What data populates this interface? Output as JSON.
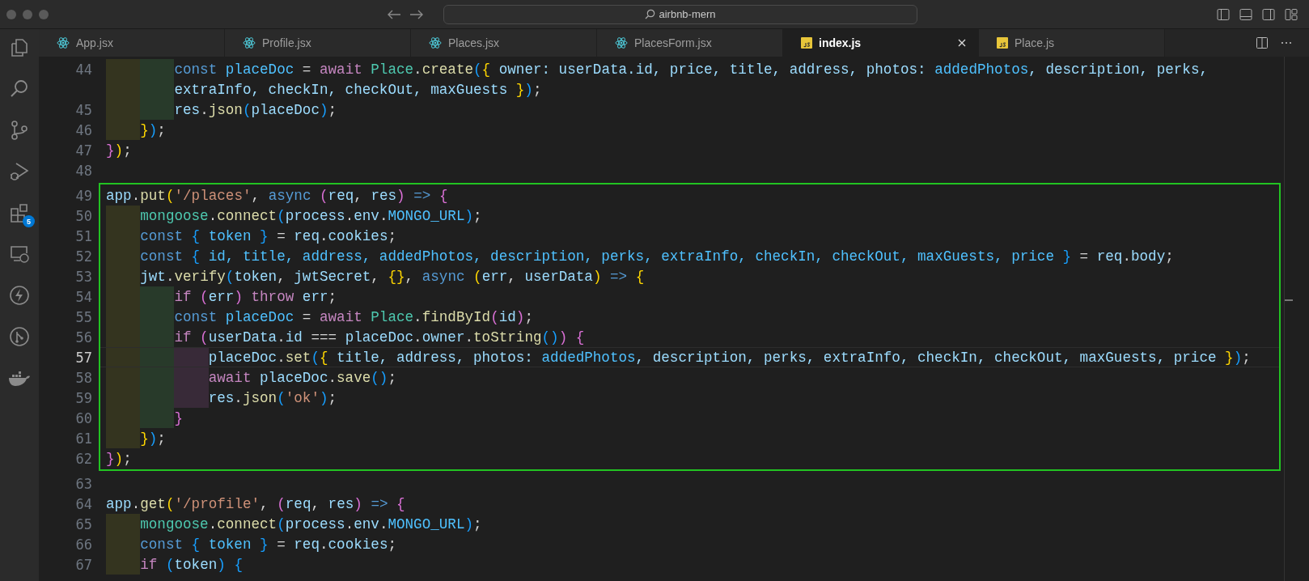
{
  "window": {
    "title": "airbnb-mern"
  },
  "activity_bar": [
    {
      "kind": "files"
    },
    {
      "kind": "search"
    },
    {
      "kind": "source-control"
    },
    {
      "kind": "run-debug"
    },
    {
      "kind": "extensions",
      "badge": "5"
    },
    {
      "kind": "remote"
    },
    {
      "kind": "lightning"
    },
    {
      "kind": "git-graph"
    },
    {
      "kind": "docker"
    }
  ],
  "tabs": [
    {
      "label": "App.jsx",
      "kind": "react",
      "selected": false
    },
    {
      "label": "Profile.jsx",
      "kind": "react",
      "selected": false
    },
    {
      "label": "Places.jsx",
      "kind": "react",
      "selected": false
    },
    {
      "label": "PlacesForm.jsx",
      "kind": "react",
      "selected": false
    },
    {
      "label": "index.js",
      "kind": "js",
      "selected": true
    },
    {
      "label": "Place.js",
      "kind": "js",
      "selected": false
    }
  ],
  "editor": {
    "blocks": [
      {
        "highlighted": false,
        "rows": [
          {
            "number": "44",
            "current": false,
            "guides": [
              {
                "color": "#34341f"
              },
              {
                "color": "#283a2a"
              }
            ],
            "tokens": [
              {
                "kind": "storage",
                "text": "const"
              },
              {
                "kind": "const",
                "text": " placeDoc"
              },
              {
                "kind": "plain",
                "text": " = "
              },
              {
                "kind": "keyword",
                "text": "await"
              },
              {
                "kind": "class",
                "text": " Place"
              },
              {
                "kind": "plain",
                "text": "."
              },
              {
                "kind": "function",
                "text": "create"
              },
              {
                "kind": "b3",
                "text": "("
              },
              {
                "kind": "b1",
                "text": "{"
              },
              {
                "kind": "variable",
                "text": " owner: userData.id, price, title, address, photos: "
              },
              {
                "kind": "const",
                "text": "addedPhotos"
              },
              {
                "kind": "variable",
                "text": ", description, perks,"
              }
            ]
          },
          {
            "current": false,
            "guides": [
              {
                "color": "#34341f"
              },
              {
                "color": "#283a2a"
              }
            ],
            "tokens": [
              {
                "kind": "variable",
                "text": "extraInfo, checkIn, checkOut, maxGuests "
              },
              {
                "kind": "b1",
                "text": "}"
              },
              {
                "kind": "b3",
                "text": ")"
              },
              {
                "kind": "plain",
                "text": ";"
              }
            ]
          },
          {
            "number": "45",
            "current": false,
            "guides": [
              {
                "color": "#34341f"
              },
              {
                "color": "#283a2a"
              }
            ],
            "tokens": [
              {
                "kind": "variable",
                "text": "res"
              },
              {
                "kind": "plain",
                "text": "."
              },
              {
                "kind": "function",
                "text": "json"
              },
              {
                "kind": "b3",
                "text": "("
              },
              {
                "kind": "variable",
                "text": "placeDoc"
              },
              {
                "kind": "b3",
                "text": ")"
              },
              {
                "kind": "plain",
                "text": ";"
              }
            ]
          },
          {
            "number": "46",
            "current": false,
            "guides": [
              {
                "color": "#34341f"
              }
            ],
            "tokens": [
              {
                "kind": "b1",
                "text": "}"
              },
              {
                "kind": "b3",
                "text": ")"
              },
              {
                "kind": "plain",
                "text": ";"
              }
            ]
          },
          {
            "number": "47",
            "current": false,
            "guides": [],
            "tokens": [
              {
                "kind": "b2",
                "text": "}"
              },
              {
                "kind": "b1",
                "text": ")"
              },
              {
                "kind": "plain",
                "text": ";"
              }
            ]
          },
          {
            "number": "48",
            "current": false,
            "guides": [],
            "tokens": []
          }
        ]
      },
      {
        "highlighted": true,
        "rows": [
          {
            "number": "49",
            "current": false,
            "guides": [],
            "tokens": [
              {
                "kind": "variable",
                "text": "app"
              },
              {
                "kind": "plain",
                "text": "."
              },
              {
                "kind": "function",
                "text": "put"
              },
              {
                "kind": "b1",
                "text": "("
              },
              {
                "kind": "string",
                "text": "'/places'"
              },
              {
                "kind": "plain",
                "text": ", "
              },
              {
                "kind": "storage",
                "text": "async"
              },
              {
                "kind": "b2",
                "text": " ("
              },
              {
                "kind": "variable",
                "text": "req"
              },
              {
                "kind": "plain",
                "text": ", "
              },
              {
                "kind": "variable",
                "text": "res"
              },
              {
                "kind": "b2",
                "text": ")"
              },
              {
                "kind": "storage",
                "text": " =>"
              },
              {
                "kind": "b2",
                "text": " {"
              }
            ]
          },
          {
            "number": "50",
            "current": false,
            "guides": [
              {
                "color": "#34341f"
              }
            ],
            "tokens": [
              {
                "kind": "class",
                "text": "mongoose"
              },
              {
                "kind": "plain",
                "text": "."
              },
              {
                "kind": "function",
                "text": "connect"
              },
              {
                "kind": "b3",
                "text": "("
              },
              {
                "kind": "variable",
                "text": "process"
              },
              {
                "kind": "plain",
                "text": "."
              },
              {
                "kind": "variable",
                "text": "env"
              },
              {
                "kind": "plain",
                "text": "."
              },
              {
                "kind": "const",
                "text": "MONGO_URL"
              },
              {
                "kind": "b3",
                "text": ")"
              },
              {
                "kind": "plain",
                "text": ";"
              }
            ]
          },
          {
            "number": "51",
            "current": false,
            "guides": [
              {
                "color": "#34341f"
              }
            ],
            "tokens": [
              {
                "kind": "storage",
                "text": "const"
              },
              {
                "kind": "b3",
                "text": " {"
              },
              {
                "kind": "const",
                "text": " token"
              },
              {
                "kind": "b3",
                "text": " }"
              },
              {
                "kind": "plain",
                "text": " = "
              },
              {
                "kind": "variable",
                "text": "req"
              },
              {
                "kind": "plain",
                "text": "."
              },
              {
                "kind": "variable",
                "text": "cookies"
              },
              {
                "kind": "plain",
                "text": ";"
              }
            ]
          },
          {
            "number": "52",
            "current": false,
            "guides": [
              {
                "color": "#34341f"
              }
            ],
            "tokens": [
              {
                "kind": "storage",
                "text": "const"
              },
              {
                "kind": "b3",
                "text": " {"
              },
              {
                "kind": "const",
                "text": " id, title, address, addedPhotos, description, perks, extraInfo, checkIn, checkOut, maxGuests, price "
              },
              {
                "kind": "b3",
                "text": "}"
              },
              {
                "kind": "plain",
                "text": " = "
              },
              {
                "kind": "variable",
                "text": "req"
              },
              {
                "kind": "plain",
                "text": "."
              },
              {
                "kind": "variable",
                "text": "body"
              },
              {
                "kind": "plain",
                "text": ";"
              }
            ]
          },
          {
            "number": "53",
            "current": false,
            "guides": [
              {
                "color": "#34341f"
              }
            ],
            "tokens": [
              {
                "kind": "variable",
                "text": "jwt"
              },
              {
                "kind": "plain",
                "text": "."
              },
              {
                "kind": "function",
                "text": "verify"
              },
              {
                "kind": "b3",
                "text": "("
              },
              {
                "kind": "variable",
                "text": "token"
              },
              {
                "kind": "plain",
                "text": ", "
              },
              {
                "kind": "variable",
                "text": "jwtSecret"
              },
              {
                "kind": "plain",
                "text": ", "
              },
              {
                "kind": "b1",
                "text": "{}"
              },
              {
                "kind": "plain",
                "text": ", "
              },
              {
                "kind": "storage",
                "text": "async"
              },
              {
                "kind": "b1",
                "text": " ("
              },
              {
                "kind": "variable",
                "text": "err"
              },
              {
                "kind": "plain",
                "text": ", "
              },
              {
                "kind": "variable",
                "text": "userData"
              },
              {
                "kind": "b1",
                "text": ")"
              },
              {
                "kind": "storage",
                "text": " =>"
              },
              {
                "kind": "b1",
                "text": " {"
              }
            ]
          },
          {
            "number": "54",
            "current": false,
            "guides": [
              {
                "color": "#34341f"
              },
              {
                "color": "#283a2a"
              }
            ],
            "tokens": [
              {
                "kind": "keyword",
                "text": "if"
              },
              {
                "kind": "b2",
                "text": " ("
              },
              {
                "kind": "variable",
                "text": "err"
              },
              {
                "kind": "b2",
                "text": ")"
              },
              {
                "kind": "keyword",
                "text": " throw"
              },
              {
                "kind": "variable",
                "text": " err"
              },
              {
                "kind": "plain",
                "text": ";"
              }
            ]
          },
          {
            "number": "55",
            "current": false,
            "guides": [
              {
                "color": "#34341f"
              },
              {
                "color": "#283a2a"
              }
            ],
            "tokens": [
              {
                "kind": "storage",
                "text": "const"
              },
              {
                "kind": "const",
                "text": " placeDoc"
              },
              {
                "kind": "plain",
                "text": " = "
              },
              {
                "kind": "keyword",
                "text": "await"
              },
              {
                "kind": "class",
                "text": " Place"
              },
              {
                "kind": "plain",
                "text": "."
              },
              {
                "kind": "function",
                "text": "findById"
              },
              {
                "kind": "b2",
                "text": "("
              },
              {
                "kind": "variable",
                "text": "id"
              },
              {
                "kind": "b2",
                "text": ")"
              },
              {
                "kind": "plain",
                "text": ";"
              }
            ]
          },
          {
            "number": "56",
            "current": false,
            "guides": [
              {
                "color": "#34341f"
              },
              {
                "color": "#283a2a"
              }
            ],
            "tokens": [
              {
                "kind": "keyword",
                "text": "if"
              },
              {
                "kind": "b2",
                "text": " ("
              },
              {
                "kind": "variable",
                "text": "userData"
              },
              {
                "kind": "plain",
                "text": "."
              },
              {
                "kind": "variable",
                "text": "id"
              },
              {
                "kind": "plain",
                "text": " === "
              },
              {
                "kind": "variable",
                "text": "placeDoc"
              },
              {
                "kind": "plain",
                "text": "."
              },
              {
                "kind": "variable",
                "text": "owner"
              },
              {
                "kind": "plain",
                "text": "."
              },
              {
                "kind": "function",
                "text": "toString"
              },
              {
                "kind": "b3",
                "text": "()"
              },
              {
                "kind": "b2",
                "text": ")"
              },
              {
                "kind": "b2",
                "text": " {"
              }
            ]
          },
          {
            "number": "57",
            "current": true,
            "guides": [
              {
                "color": "#34341f"
              },
              {
                "color": "#283a2a"
              },
              {
                "color": "#382a38"
              }
            ],
            "tokens": [
              {
                "kind": "variable",
                "text": "placeDoc"
              },
              {
                "kind": "plain",
                "text": "."
              },
              {
                "kind": "function",
                "text": "set"
              },
              {
                "kind": "b3",
                "text": "("
              },
              {
                "kind": "b1",
                "text": "{"
              },
              {
                "kind": "variable",
                "text": " title, address, photos: "
              },
              {
                "kind": "const",
                "text": "addedPhotos"
              },
              {
                "kind": "variable",
                "text": ", description, perks, extraInfo, checkIn, checkOut, maxGuests, price "
              },
              {
                "kind": "b1",
                "text": "}"
              },
              {
                "kind": "b3",
                "text": ")"
              },
              {
                "kind": "plain",
                "text": ";"
              }
            ]
          },
          {
            "number": "58",
            "current": false,
            "guides": [
              {
                "color": "#34341f"
              },
              {
                "color": "#283a2a"
              },
              {
                "color": "#382a38"
              }
            ],
            "tokens": [
              {
                "kind": "keyword",
                "text": "await"
              },
              {
                "kind": "variable",
                "text": " placeDoc"
              },
              {
                "kind": "plain",
                "text": "."
              },
              {
                "kind": "function",
                "text": "save"
              },
              {
                "kind": "b3",
                "text": "()"
              },
              {
                "kind": "plain",
                "text": ";"
              }
            ]
          },
          {
            "number": "59",
            "current": false,
            "guides": [
              {
                "color": "#34341f"
              },
              {
                "color": "#283a2a"
              },
              {
                "color": "#382a38"
              }
            ],
            "tokens": [
              {
                "kind": "variable",
                "text": "res"
              },
              {
                "kind": "plain",
                "text": "."
              },
              {
                "kind": "function",
                "text": "json"
              },
              {
                "kind": "b3",
                "text": "("
              },
              {
                "kind": "string",
                "text": "'ok'"
              },
              {
                "kind": "b3",
                "text": ")"
              },
              {
                "kind": "plain",
                "text": ";"
              }
            ]
          },
          {
            "number": "60",
            "current": false,
            "guides": [
              {
                "color": "#34341f"
              },
              {
                "color": "#283a2a"
              }
            ],
            "tokens": [
              {
                "kind": "b2",
                "text": "}"
              }
            ]
          },
          {
            "number": "61",
            "current": false,
            "guides": [
              {
                "color": "#34341f"
              }
            ],
            "tokens": [
              {
                "kind": "b1",
                "text": "}"
              },
              {
                "kind": "b3",
                "text": ")"
              },
              {
                "kind": "plain",
                "text": ";"
              }
            ]
          },
          {
            "number": "62",
            "current": false,
            "guides": [],
            "tokens": [
              {
                "kind": "b2",
                "text": "}"
              },
              {
                "kind": "b1",
                "text": ")"
              },
              {
                "kind": "plain",
                "text": ";"
              }
            ]
          }
        ]
      },
      {
        "highlighted": false,
        "rows": [
          {
            "number": "63",
            "current": false,
            "guides": [],
            "tokens": []
          },
          {
            "number": "64",
            "current": false,
            "guides": [],
            "tokens": [
              {
                "kind": "variable",
                "text": "app"
              },
              {
                "kind": "plain",
                "text": "."
              },
              {
                "kind": "function",
                "text": "get"
              },
              {
                "kind": "b1",
                "text": "("
              },
              {
                "kind": "string",
                "text": "'/profile'"
              },
              {
                "kind": "plain",
                "text": ", "
              },
              {
                "kind": "b2",
                "text": "("
              },
              {
                "kind": "variable",
                "text": "req"
              },
              {
                "kind": "plain",
                "text": ", "
              },
              {
                "kind": "variable",
                "text": "res"
              },
              {
                "kind": "b2",
                "text": ")"
              },
              {
                "kind": "storage",
                "text": " =>"
              },
              {
                "kind": "b2",
                "text": " {"
              }
            ]
          },
          {
            "number": "65",
            "current": false,
            "guides": [
              {
                "color": "#34341f"
              }
            ],
            "tokens": [
              {
                "kind": "class",
                "text": "mongoose"
              },
              {
                "kind": "plain",
                "text": "."
              },
              {
                "kind": "function",
                "text": "connect"
              },
              {
                "kind": "b3",
                "text": "("
              },
              {
                "kind": "variable",
                "text": "process"
              },
              {
                "kind": "plain",
                "text": "."
              },
              {
                "kind": "variable",
                "text": "env"
              },
              {
                "kind": "plain",
                "text": "."
              },
              {
                "kind": "const",
                "text": "MONGO_URL"
              },
              {
                "kind": "b3",
                "text": ")"
              },
              {
                "kind": "plain",
                "text": ";"
              }
            ]
          },
          {
            "number": "66",
            "current": false,
            "guides": [
              {
                "color": "#34341f"
              }
            ],
            "tokens": [
              {
                "kind": "storage",
                "text": "const"
              },
              {
                "kind": "b3",
                "text": " {"
              },
              {
                "kind": "const",
                "text": " token"
              },
              {
                "kind": "b3",
                "text": " }"
              },
              {
                "kind": "plain",
                "text": " = "
              },
              {
                "kind": "variable",
                "text": "req"
              },
              {
                "kind": "plain",
                "text": "."
              },
              {
                "kind": "variable",
                "text": "cookies"
              },
              {
                "kind": "plain",
                "text": ";"
              }
            ]
          },
          {
            "number": "67",
            "current": false,
            "guides": [
              {
                "color": "#34341f"
              }
            ],
            "tokens": [
              {
                "kind": "keyword",
                "text": "if"
              },
              {
                "kind": "b3",
                "text": " ("
              },
              {
                "kind": "variable",
                "text": "token"
              },
              {
                "kind": "b3",
                "text": ")"
              },
              {
                "kind": "b3",
                "text": " {"
              }
            ]
          }
        ]
      }
    ]
  }
}
